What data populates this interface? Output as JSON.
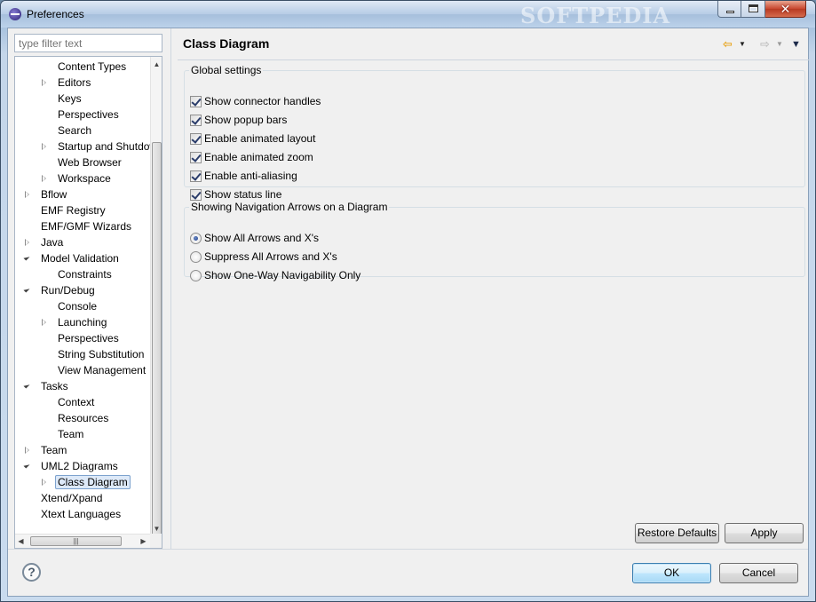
{
  "window": {
    "title": "Preferences",
    "watermark": "SOFTPEDIA"
  },
  "filter": {
    "placeholder": "type filter text"
  },
  "tree": {
    "items": [
      {
        "label": "Content Types",
        "level": 2,
        "state": "none"
      },
      {
        "label": "Editors",
        "level": 2,
        "state": "collapsed"
      },
      {
        "label": "Keys",
        "level": 2,
        "state": "none"
      },
      {
        "label": "Perspectives",
        "level": 2,
        "state": "none"
      },
      {
        "label": "Search",
        "level": 2,
        "state": "none"
      },
      {
        "label": "Startup and Shutdow",
        "level": 2,
        "state": "collapsed"
      },
      {
        "label": "Web Browser",
        "level": 2,
        "state": "none"
      },
      {
        "label": "Workspace",
        "level": 2,
        "state": "collapsed"
      },
      {
        "label": "Bflow",
        "level": 1,
        "state": "collapsed"
      },
      {
        "label": "EMF Registry",
        "level": 1,
        "state": "none"
      },
      {
        "label": "EMF/GMF Wizards",
        "level": 1,
        "state": "none"
      },
      {
        "label": "Java",
        "level": 1,
        "state": "collapsed"
      },
      {
        "label": "Model Validation",
        "level": 1,
        "state": "expanded"
      },
      {
        "label": "Constraints",
        "level": 2,
        "state": "none"
      },
      {
        "label": "Run/Debug",
        "level": 1,
        "state": "expanded"
      },
      {
        "label": "Console",
        "level": 2,
        "state": "none"
      },
      {
        "label": "Launching",
        "level": 2,
        "state": "collapsed"
      },
      {
        "label": "Perspectives",
        "level": 2,
        "state": "none"
      },
      {
        "label": "String Substitution",
        "level": 2,
        "state": "none"
      },
      {
        "label": "View Management",
        "level": 2,
        "state": "none"
      },
      {
        "label": "Tasks",
        "level": 1,
        "state": "expanded"
      },
      {
        "label": "Context",
        "level": 2,
        "state": "none"
      },
      {
        "label": "Resources",
        "level": 2,
        "state": "none"
      },
      {
        "label": "Team",
        "level": 2,
        "state": "none"
      },
      {
        "label": "Team",
        "level": 1,
        "state": "collapsed"
      },
      {
        "label": "UML2 Diagrams",
        "level": 1,
        "state": "expanded"
      },
      {
        "label": "Class Diagram",
        "level": 2,
        "state": "collapsed",
        "selected": true
      },
      {
        "label": "Xtend/Xpand",
        "level": 1,
        "state": "none"
      },
      {
        "label": "Xtext Languages",
        "level": 1,
        "state": "none"
      }
    ]
  },
  "page": {
    "title": "Class Diagram",
    "global_settings": {
      "legend": "Global settings",
      "options": [
        {
          "label": "Show connector handles",
          "checked": true
        },
        {
          "label": "Show popup bars",
          "checked": true
        },
        {
          "label": "Enable animated layout",
          "checked": true
        },
        {
          "label": "Enable animated zoom",
          "checked": true
        },
        {
          "label": "Enable anti-aliasing",
          "checked": true
        },
        {
          "label": "Show status line",
          "checked": true
        }
      ]
    },
    "navigation_arrows": {
      "legend": "Showing Navigation Arrows on a Diagram",
      "options": [
        {
          "label": "Show All Arrows and X's",
          "selected": true
        },
        {
          "label": "Suppress All Arrows and X's",
          "selected": false
        },
        {
          "label": "Show One-Way Navigability Only",
          "selected": false
        }
      ]
    },
    "restore_defaults": "Restore Defaults",
    "apply": "Apply"
  },
  "footer": {
    "help": "?",
    "ok": "OK",
    "cancel": "Cancel"
  },
  "icons": {
    "back": "back-arrow-icon",
    "forward": "forward-arrow-icon",
    "menu": "view-menu-icon"
  },
  "colors": {
    "back_arrow": "#e8a317",
    "selection_bg": "#dde9f8",
    "selection_border": "#7da2ce"
  }
}
